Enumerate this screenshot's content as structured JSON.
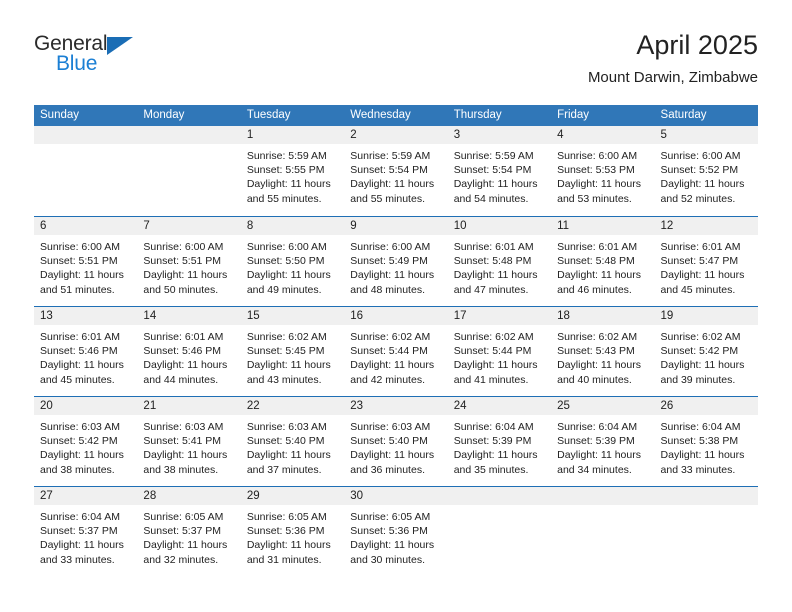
{
  "brand": {
    "name_part1": "General",
    "name_part2": "Blue",
    "triangle_icon": "triangle-icon",
    "color_dark": "#2b2b2b",
    "color_blue": "#1b7fd4"
  },
  "header": {
    "month_year": "April 2025",
    "location": "Mount Darwin, Zimbabwe"
  },
  "theme": {
    "header_blue": "#3077b8",
    "separator_blue": "#1f6fb5",
    "daynum_band": "#f0f0f0",
    "text": "#222222"
  },
  "weekdays": [
    "Sunday",
    "Monday",
    "Tuesday",
    "Wednesday",
    "Thursday",
    "Friday",
    "Saturday"
  ],
  "weeks": [
    [
      {
        "day": "",
        "l1": "",
        "l2": "",
        "l3": "",
        "l4": ""
      },
      {
        "day": "",
        "l1": "",
        "l2": "",
        "l3": "",
        "l4": ""
      },
      {
        "day": "1",
        "l1": "Sunrise: 5:59 AM",
        "l2": "Sunset: 5:55 PM",
        "l3": "Daylight: 11 hours",
        "l4": "and 55 minutes."
      },
      {
        "day": "2",
        "l1": "Sunrise: 5:59 AM",
        "l2": "Sunset: 5:54 PM",
        "l3": "Daylight: 11 hours",
        "l4": "and 55 minutes."
      },
      {
        "day": "3",
        "l1": "Sunrise: 5:59 AM",
        "l2": "Sunset: 5:54 PM",
        "l3": "Daylight: 11 hours",
        "l4": "and 54 minutes."
      },
      {
        "day": "4",
        "l1": "Sunrise: 6:00 AM",
        "l2": "Sunset: 5:53 PM",
        "l3": "Daylight: 11 hours",
        "l4": "and 53 minutes."
      },
      {
        "day": "5",
        "l1": "Sunrise: 6:00 AM",
        "l2": "Sunset: 5:52 PM",
        "l3": "Daylight: 11 hours",
        "l4": "and 52 minutes."
      }
    ],
    [
      {
        "day": "6",
        "l1": "Sunrise: 6:00 AM",
        "l2": "Sunset: 5:51 PM",
        "l3": "Daylight: 11 hours",
        "l4": "and 51 minutes."
      },
      {
        "day": "7",
        "l1": "Sunrise: 6:00 AM",
        "l2": "Sunset: 5:51 PM",
        "l3": "Daylight: 11 hours",
        "l4": "and 50 minutes."
      },
      {
        "day": "8",
        "l1": "Sunrise: 6:00 AM",
        "l2": "Sunset: 5:50 PM",
        "l3": "Daylight: 11 hours",
        "l4": "and 49 minutes."
      },
      {
        "day": "9",
        "l1": "Sunrise: 6:00 AM",
        "l2": "Sunset: 5:49 PM",
        "l3": "Daylight: 11 hours",
        "l4": "and 48 minutes."
      },
      {
        "day": "10",
        "l1": "Sunrise: 6:01 AM",
        "l2": "Sunset: 5:48 PM",
        "l3": "Daylight: 11 hours",
        "l4": "and 47 minutes."
      },
      {
        "day": "11",
        "l1": "Sunrise: 6:01 AM",
        "l2": "Sunset: 5:48 PM",
        "l3": "Daylight: 11 hours",
        "l4": "and 46 minutes."
      },
      {
        "day": "12",
        "l1": "Sunrise: 6:01 AM",
        "l2": "Sunset: 5:47 PM",
        "l3": "Daylight: 11 hours",
        "l4": "and 45 minutes."
      }
    ],
    [
      {
        "day": "13",
        "l1": "Sunrise: 6:01 AM",
        "l2": "Sunset: 5:46 PM",
        "l3": "Daylight: 11 hours",
        "l4": "and 45 minutes."
      },
      {
        "day": "14",
        "l1": "Sunrise: 6:01 AM",
        "l2": "Sunset: 5:46 PM",
        "l3": "Daylight: 11 hours",
        "l4": "and 44 minutes."
      },
      {
        "day": "15",
        "l1": "Sunrise: 6:02 AM",
        "l2": "Sunset: 5:45 PM",
        "l3": "Daylight: 11 hours",
        "l4": "and 43 minutes."
      },
      {
        "day": "16",
        "l1": "Sunrise: 6:02 AM",
        "l2": "Sunset: 5:44 PM",
        "l3": "Daylight: 11 hours",
        "l4": "and 42 minutes."
      },
      {
        "day": "17",
        "l1": "Sunrise: 6:02 AM",
        "l2": "Sunset: 5:44 PM",
        "l3": "Daylight: 11 hours",
        "l4": "and 41 minutes."
      },
      {
        "day": "18",
        "l1": "Sunrise: 6:02 AM",
        "l2": "Sunset: 5:43 PM",
        "l3": "Daylight: 11 hours",
        "l4": "and 40 minutes."
      },
      {
        "day": "19",
        "l1": "Sunrise: 6:02 AM",
        "l2": "Sunset: 5:42 PM",
        "l3": "Daylight: 11 hours",
        "l4": "and 39 minutes."
      }
    ],
    [
      {
        "day": "20",
        "l1": "Sunrise: 6:03 AM",
        "l2": "Sunset: 5:42 PM",
        "l3": "Daylight: 11 hours",
        "l4": "and 38 minutes."
      },
      {
        "day": "21",
        "l1": "Sunrise: 6:03 AM",
        "l2": "Sunset: 5:41 PM",
        "l3": "Daylight: 11 hours",
        "l4": "and 38 minutes."
      },
      {
        "day": "22",
        "l1": "Sunrise: 6:03 AM",
        "l2": "Sunset: 5:40 PM",
        "l3": "Daylight: 11 hours",
        "l4": "and 37 minutes."
      },
      {
        "day": "23",
        "l1": "Sunrise: 6:03 AM",
        "l2": "Sunset: 5:40 PM",
        "l3": "Daylight: 11 hours",
        "l4": "and 36 minutes."
      },
      {
        "day": "24",
        "l1": "Sunrise: 6:04 AM",
        "l2": "Sunset: 5:39 PM",
        "l3": "Daylight: 11 hours",
        "l4": "and 35 minutes."
      },
      {
        "day": "25",
        "l1": "Sunrise: 6:04 AM",
        "l2": "Sunset: 5:39 PM",
        "l3": "Daylight: 11 hours",
        "l4": "and 34 minutes."
      },
      {
        "day": "26",
        "l1": "Sunrise: 6:04 AM",
        "l2": "Sunset: 5:38 PM",
        "l3": "Daylight: 11 hours",
        "l4": "and 33 minutes."
      }
    ],
    [
      {
        "day": "27",
        "l1": "Sunrise: 6:04 AM",
        "l2": "Sunset: 5:37 PM",
        "l3": "Daylight: 11 hours",
        "l4": "and 33 minutes."
      },
      {
        "day": "28",
        "l1": "Sunrise: 6:05 AM",
        "l2": "Sunset: 5:37 PM",
        "l3": "Daylight: 11 hours",
        "l4": "and 32 minutes."
      },
      {
        "day": "29",
        "l1": "Sunrise: 6:05 AM",
        "l2": "Sunset: 5:36 PM",
        "l3": "Daylight: 11 hours",
        "l4": "and 31 minutes."
      },
      {
        "day": "30",
        "l1": "Sunrise: 6:05 AM",
        "l2": "Sunset: 5:36 PM",
        "l3": "Daylight: 11 hours",
        "l4": "and 30 minutes."
      },
      {
        "day": "",
        "l1": "",
        "l2": "",
        "l3": "",
        "l4": ""
      },
      {
        "day": "",
        "l1": "",
        "l2": "",
        "l3": "",
        "l4": ""
      },
      {
        "day": "",
        "l1": "",
        "l2": "",
        "l3": "",
        "l4": ""
      }
    ]
  ]
}
